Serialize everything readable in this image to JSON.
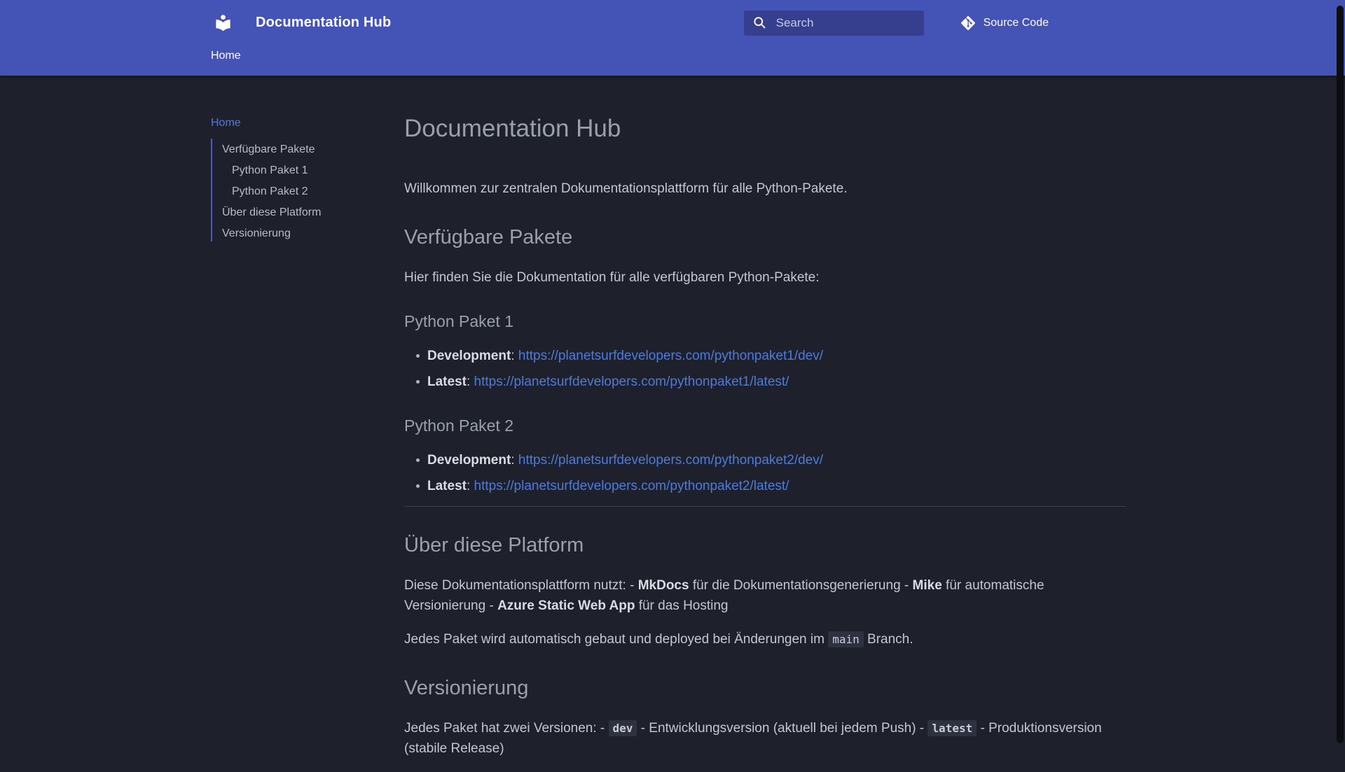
{
  "header": {
    "title": "Documentation Hub",
    "search": {
      "placeholder": "Search"
    },
    "source": {
      "label": "Source Code"
    },
    "tabs": [
      {
        "label": "Home"
      }
    ]
  },
  "sidebar": {
    "home_label": "Home",
    "toc": [
      {
        "label": "Verfügbare Pakete",
        "level": 1
      },
      {
        "label": "Python Paket 1",
        "level": 2
      },
      {
        "label": "Python Paket 2",
        "level": 2
      },
      {
        "label": "Über diese Platform",
        "level": 1
      },
      {
        "label": "Versionierung",
        "level": 1
      }
    ]
  },
  "content": {
    "title": "Documentation Hub",
    "intro": "Willkommen zur zentralen Dokumentationsplattform für alle Python-Pakete.",
    "available": {
      "heading": "Verfügbare Pakete",
      "intro": "Hier finden Sie die Dokumentation für alle verfügbaren Python-Pakete:",
      "colon": ": ",
      "packages": [
        {
          "name": "Python Paket 1",
          "links": [
            {
              "label": "Development",
              "url": "https://planetsurfdevelopers.com/pythonpaket1/dev/"
            },
            {
              "label": "Latest",
              "url": "https://planetsurfdevelopers.com/pythonpaket1/latest/"
            }
          ]
        },
        {
          "name": "Python Paket 2",
          "links": [
            {
              "label": "Development",
              "url": "https://planetsurfdevelopers.com/pythonpaket2/dev/"
            },
            {
              "label": "Latest",
              "url": "https://planetsurfdevelopers.com/pythonpaket2/latest/"
            }
          ]
        }
      ]
    },
    "about": {
      "heading": "Über diese Platform",
      "p1": [
        {
          "text": "Diese Dokumentationsplattform nutzt: - "
        },
        {
          "text": "MkDocs",
          "bold": true
        },
        {
          "text": " für die Dokumentationsgenerierung - "
        },
        {
          "text": "Mike",
          "bold": true
        },
        {
          "text": " für automatische Versionierung - "
        },
        {
          "text": "Azure Static Web App",
          "bold": true
        },
        {
          "text": " für das Hosting"
        }
      ],
      "p2_before": "Jedes Paket wird automatisch gebaut und deployed bei Änderungen im ",
      "p2_code": "main",
      "p2_after": " Branch."
    },
    "versioning": {
      "heading": "Versionierung",
      "p_before": "Jedes Paket hat zwei Versionen: - ",
      "code_dev": "dev",
      "p_mid": " - Entwicklungsversion (aktuell bei jedem Push) - ",
      "code_latest": "latest",
      "p_after": " - Produktionsversion (stabile Release)"
    }
  },
  "colors": {
    "header_bg": "#4453b6",
    "page_bg": "#1e212b",
    "link": "#4e7bdb",
    "toc_accent": "#4a5abf"
  }
}
